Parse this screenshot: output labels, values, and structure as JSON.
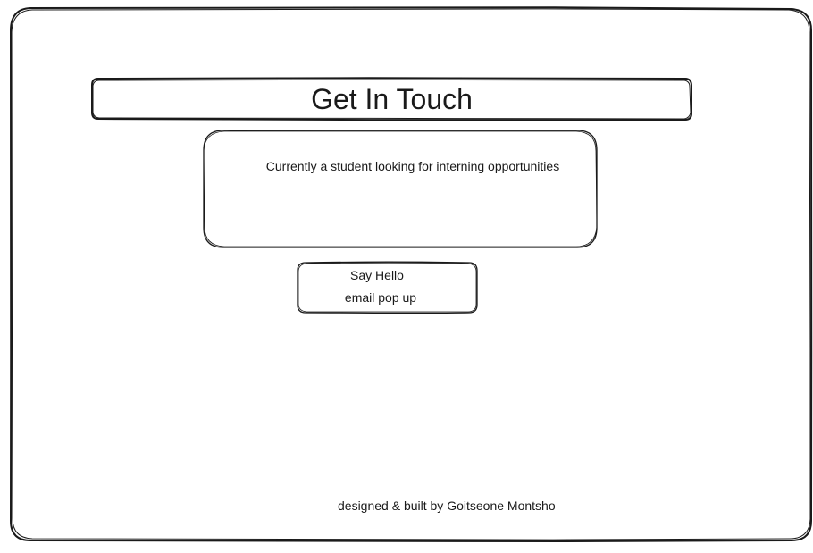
{
  "header": {
    "title": "Get In Touch"
  },
  "about": {
    "text": "Currently a student looking for interning opportunities"
  },
  "contact": {
    "button_label": "Say Hello",
    "popup_note": "email pop up"
  },
  "footer": {
    "credit": "designed & built by Goitseone Montsho"
  },
  "colors": {
    "stroke": "#1a1a1a",
    "background": "#ffffff"
  }
}
